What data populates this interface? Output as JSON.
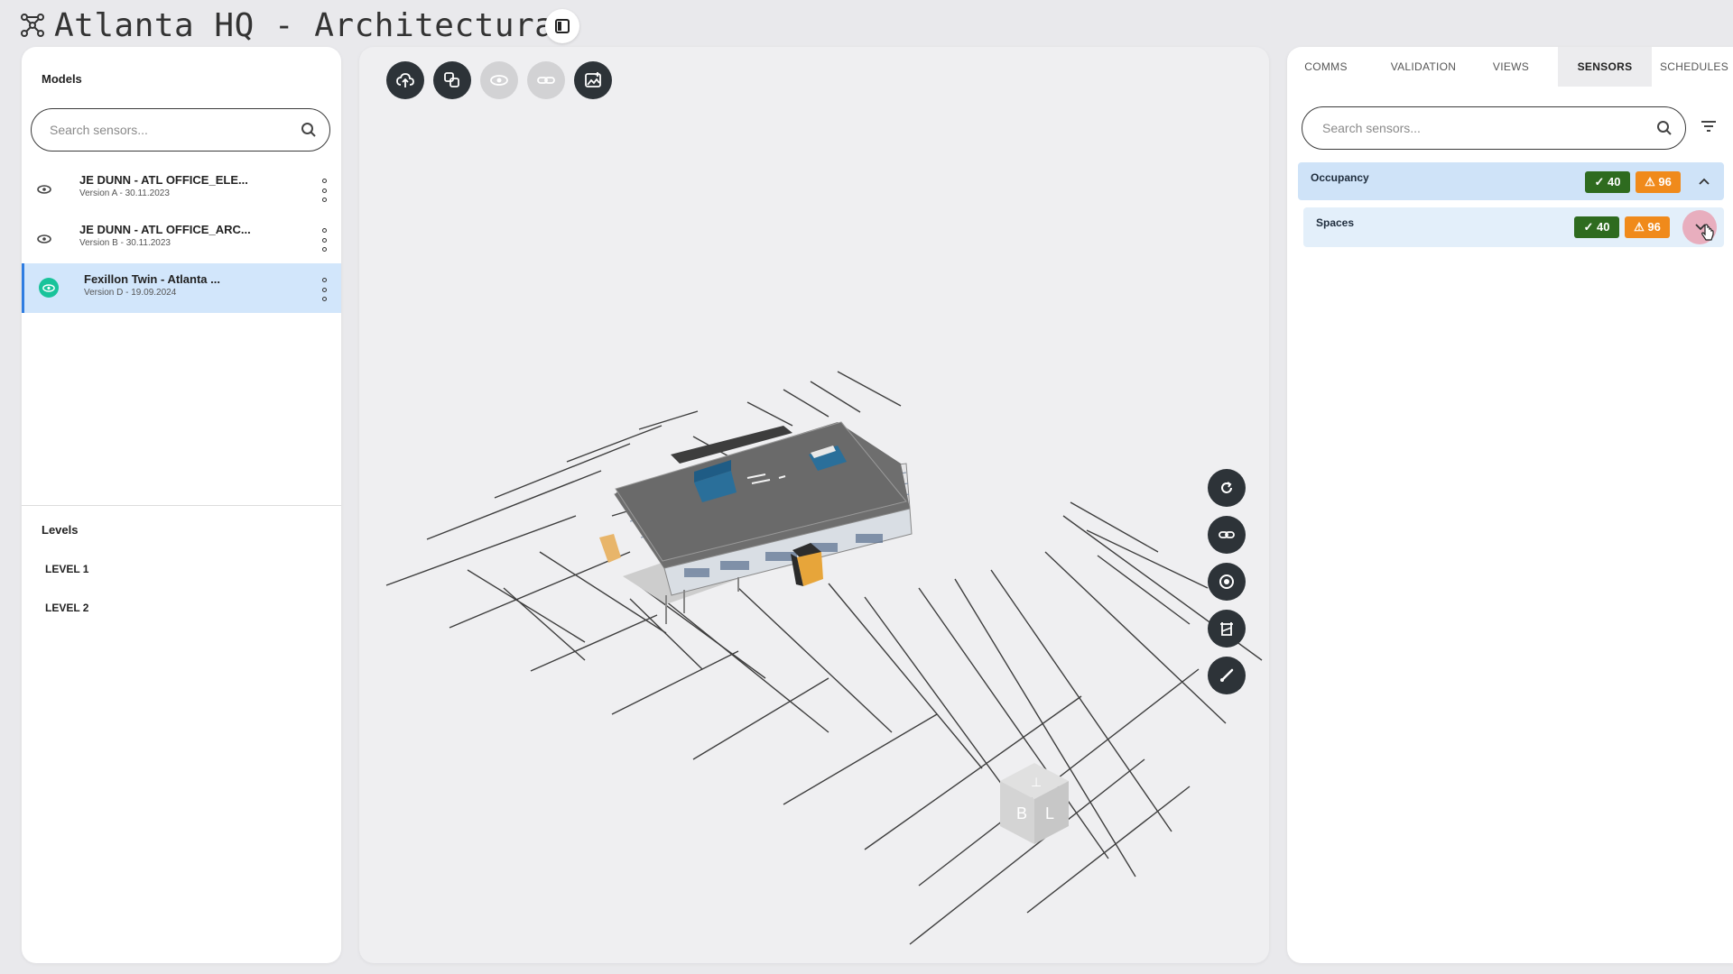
{
  "header": {
    "title": "Atlanta HQ - Architectural",
    "logo_icon": "network-logo-icon",
    "toggle_icon": "sidebar-toggle-icon"
  },
  "left": {
    "models_label": "Models",
    "search_placeholder": "Search sensors...",
    "models": [
      {
        "name": "JE DUNN - ATL OFFICE_ELE...",
        "version": "Version A - 30.11.2023",
        "visible": false
      },
      {
        "name": "JE DUNN - ATL OFFICE_ARC...",
        "version": "Version B - 30.11.2023",
        "visible": false
      },
      {
        "name": "Fexillon Twin - Atlanta ...",
        "version": "Version D - 19.09.2024",
        "visible": true,
        "selected": true
      }
    ],
    "levels_label": "Levels",
    "levels": [
      "LEVEL 1",
      "LEVEL 2"
    ]
  },
  "viewer": {
    "toolbar_icons": [
      "cloud-upload-icon",
      "layers-icon",
      "eye-icon",
      "link-icon",
      "image-icon"
    ],
    "side_icons": [
      "refresh-icon",
      "link-icon",
      "target-icon",
      "frame-icon",
      "brush-icon"
    ],
    "navcube": {
      "left_face": "B",
      "right_face": "L",
      "top_face": "T"
    }
  },
  "right": {
    "tabs": [
      "COMMS",
      "VALIDATION",
      "VIEWS",
      "SENSORS",
      "SCHEDULES"
    ],
    "active_tab": "SENSORS",
    "search_placeholder": "Search sensors...",
    "groups": [
      {
        "label": "Occupancy",
        "ok": "✓ 40",
        "warn": "⚠ 96",
        "expanded": true
      },
      {
        "label": "Spaces",
        "ok": "✓ 40",
        "warn": "⚠ 96",
        "expanded": false
      }
    ]
  },
  "colors": {
    "accent": "#2f7de1",
    "ok": "#2e6b1f",
    "warn": "#f08a1b",
    "selected_row": "#d2e6fb",
    "eye_on": "#19c39a",
    "dark_button": "#2d3338"
  }
}
